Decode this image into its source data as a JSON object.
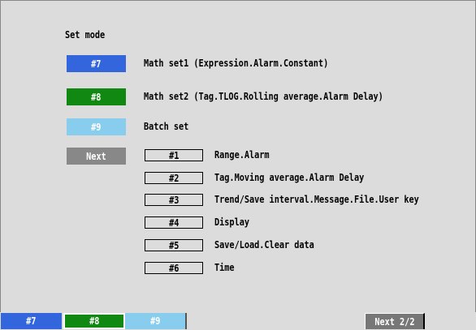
{
  "title": "Set mode",
  "menu": [
    {
      "key": "#7",
      "label": "Math set1 (Expression.Alarm.Constant)",
      "color": "#3366dd"
    },
    {
      "key": "#8",
      "label": "Math set2 (Tag.TLOG.Rolling average.Alarm Delay)",
      "color": "#118811"
    },
    {
      "key": "#9",
      "label": "Batch set",
      "color": "#88ccee"
    },
    {
      "key": "Next",
      "label": "",
      "color": "#888888"
    }
  ],
  "next_items": [
    {
      "key": "#1",
      "label": "Range.Alarm"
    },
    {
      "key": "#2",
      "label": "Tag.Moving average.Alarm Delay"
    },
    {
      "key": "#3",
      "label": "Trend/Save interval.Message.File.User key"
    },
    {
      "key": "#4",
      "label": "Display"
    },
    {
      "key": "#5",
      "label": "Save/Load.Clear data"
    },
    {
      "key": "#6",
      "label": "Time"
    }
  ],
  "soft_keys": {
    "k7": "#7",
    "k8": "#8",
    "k9": "#9",
    "next": "Next 2/2"
  }
}
